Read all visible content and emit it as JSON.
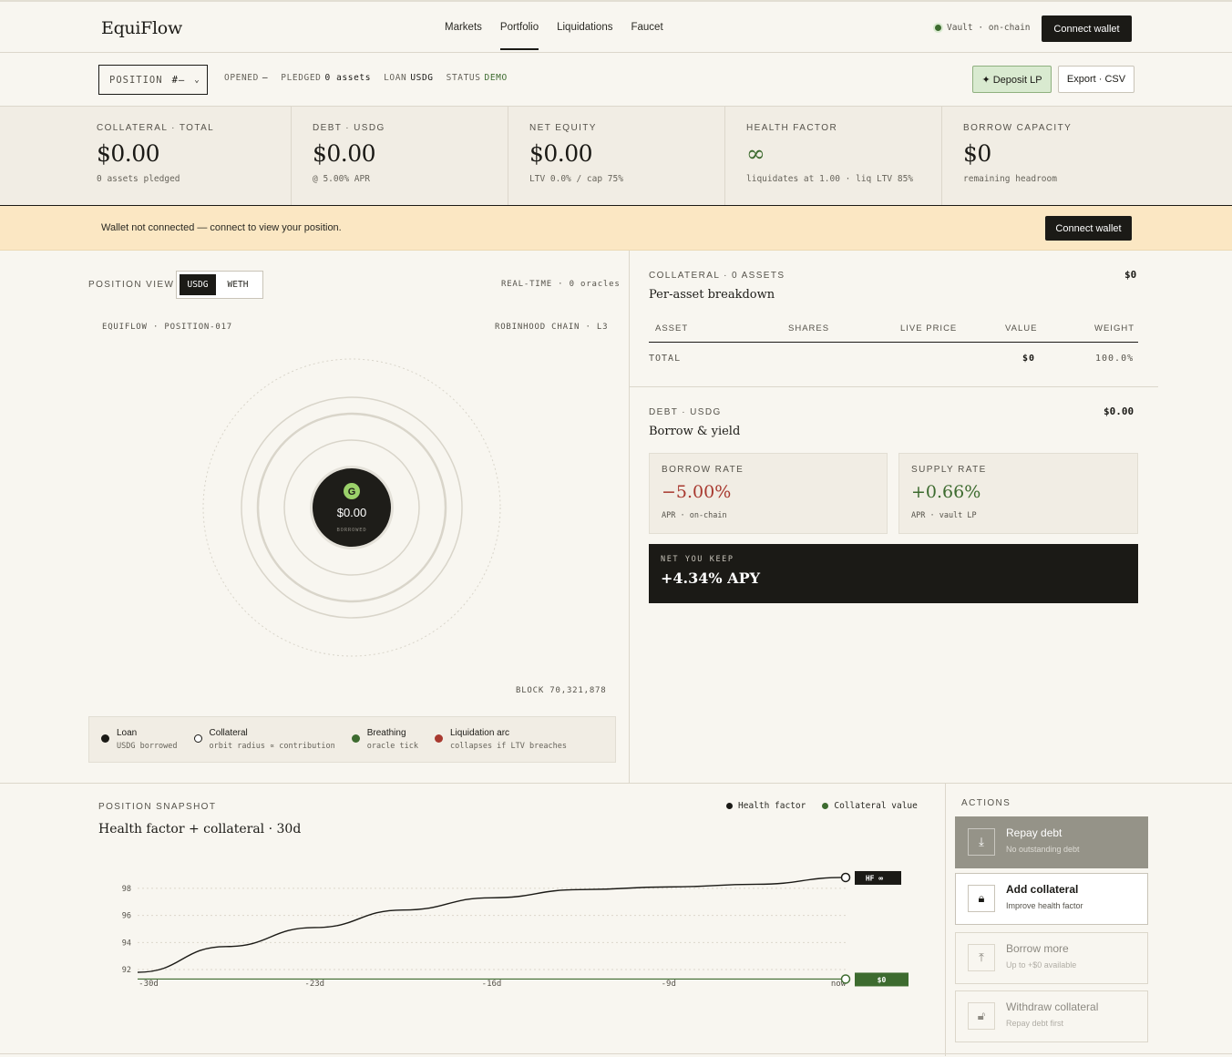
{
  "header": {
    "logo": "EquiFlow",
    "nav": [
      "Markets",
      "Portfolio",
      "Liquidations",
      "Faucet"
    ],
    "active_nav": "Portfolio",
    "vault_status": "Vault · on-chain",
    "connect_label": "Connect wallet"
  },
  "subbar": {
    "position_label": "POSITION",
    "position_value": "#—",
    "opened_label": "OPENED",
    "opened_value": "—",
    "pledged_label": "PLEDGED",
    "pledged_value": "0 assets",
    "loan_label": "LOAN",
    "loan_value": "USDG",
    "status_label": "STATUS",
    "status_value": "DEMO",
    "deposit_label": "✦ Deposit LP",
    "export_label": "Export · CSV"
  },
  "stats": [
    {
      "label": "COLLATERAL · TOTAL",
      "value": "$0.00",
      "sub": "0 assets pledged"
    },
    {
      "label": "DEBT · USDG",
      "value": "$0.00",
      "sub": "@ 5.00% APR"
    },
    {
      "label": "NET EQUITY",
      "value": "$0.00",
      "sub": "LTV 0.0% / cap 75%"
    },
    {
      "label": "HEALTH FACTOR",
      "value": "∞",
      "sub": "liquidates at 1.00 · liq LTV 85%"
    },
    {
      "label": "BORROW CAPACITY",
      "value": "$0",
      "sub": "remaining headroom"
    }
  ],
  "banner": {
    "message": "Wallet not connected — connect to view your position.",
    "button": "Connect wallet"
  },
  "position_view": {
    "label": "POSITION VIEW",
    "tabs": [
      "USDG",
      "WETH"
    ],
    "active_tab": "USDG",
    "realtime": "REAL-TIME · 0 oracles",
    "id_label": "EQUIFLOW · POSITION-017",
    "chain_label": "ROBINHOOD CHAIN · L3",
    "center_value": "$0.00",
    "center_sub": "BORROWED",
    "block": "BLOCK 70,321,878",
    "legend": [
      {
        "title": "Loan",
        "sub": "USDG borrowed",
        "color": "#1b1a16"
      },
      {
        "title": "Collateral",
        "sub": "orbit radius ∝ contribution",
        "color": "#ffffff"
      },
      {
        "title": "Breathing",
        "sub": "oracle tick",
        "color": "#3d6b2f"
      },
      {
        "title": "Liquidation arc",
        "sub": "collapses if LTV breaches",
        "color": "#a8392f"
      }
    ]
  },
  "collateral": {
    "label": "COLLATERAL · 0 ASSETS",
    "title": "Per-asset breakdown",
    "total": "$0",
    "columns": [
      "ASSET",
      "SHARES",
      "LIVE PRICE",
      "VALUE",
      "WEIGHT"
    ],
    "total_label": "TOTAL",
    "total_value": "$0",
    "total_weight": "100.0%"
  },
  "debt": {
    "label": "DEBT · USDG",
    "title": "Borrow & yield",
    "total": "$0.00",
    "borrow_label": "BORROW RATE",
    "borrow_value": "−5.00%",
    "borrow_sub": "APR · on-chain",
    "supply_label": "SUPPLY RATE",
    "supply_value": "+0.66%",
    "supply_sub": "APR · vault LP",
    "keep_label": "NET YOU KEEP",
    "keep_value": "+4.34% APY"
  },
  "snapshot": {
    "label": "POSITION SNAPSHOT",
    "title": "Health factor + collateral · 30d",
    "legend_hf": "Health factor",
    "legend_coll": "Collateral value",
    "hf_tag": "HF ∞",
    "coll_tag": "$0"
  },
  "chart_data": {
    "type": "line",
    "x": [
      "-30d",
      "-23d",
      "-16d",
      "-9d",
      "now"
    ],
    "y_ticks": [
      92,
      94,
      96,
      98
    ],
    "ylim": [
      91.6,
      99
    ],
    "series": [
      {
        "name": "Health factor",
        "color": "#1b1a16",
        "values": [
          91.8,
          93.7,
          95.1,
          96.4,
          97.3,
          97.9,
          98.1,
          98.3,
          98.8
        ]
      },
      {
        "name": "Collateral value",
        "color": "#3d6b2f",
        "values": [
          91.3,
          91.3,
          91.3,
          91.3,
          91.3,
          91.3,
          91.3,
          91.3,
          91.3
        ]
      }
    ]
  },
  "actions": {
    "label": "ACTIONS",
    "items": [
      {
        "title": "Repay debt",
        "sub": "No outstanding debt",
        "icon": "repay-icon"
      },
      {
        "title": "Add collateral",
        "sub": "Improve health factor",
        "icon": "lock-icon"
      },
      {
        "title": "Borrow more",
        "sub": "Up to +$0 available",
        "icon": "borrow-icon"
      },
      {
        "title": "Withdraw collateral",
        "sub": "Repay debt first",
        "icon": "unlock-icon"
      }
    ]
  }
}
